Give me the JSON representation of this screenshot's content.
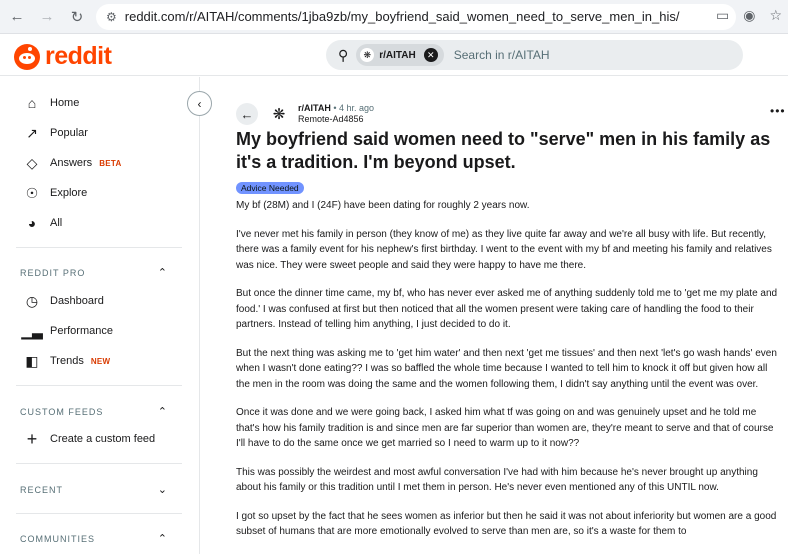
{
  "browser": {
    "url": "reddit.com/r/AITAH/comments/1jba9zb/my_boyfriend_said_women_need_to_serve_men_in_his/"
  },
  "header": {
    "logo_text": "reddit",
    "search_chip": "r/AITAH",
    "search_placeholder": "Search in r/AITAH"
  },
  "sidebar": {
    "items": [
      {
        "label": "Home",
        "icon": "home-icon"
      },
      {
        "label": "Popular",
        "icon": "popular-icon"
      },
      {
        "label": "Answers",
        "badge": "BETA",
        "icon": "answers-icon"
      },
      {
        "label": "Explore",
        "icon": "explore-icon"
      },
      {
        "label": "All",
        "icon": "all-icon"
      }
    ],
    "reddit_pro": {
      "title": "REDDIT PRO",
      "items": [
        {
          "label": "Dashboard",
          "icon": "dashboard-icon"
        },
        {
          "label": "Performance",
          "icon": "performance-icon"
        },
        {
          "label": "Trends",
          "badge": "NEW",
          "icon": "trends-icon"
        }
      ]
    },
    "custom_feeds": {
      "title": "CUSTOM FEEDS",
      "create_label": "Create a custom feed"
    },
    "recent_title": "RECENT",
    "communities_title": "COMMUNITIES"
  },
  "post": {
    "subreddit": "r/AITAH",
    "time": "• 4 hr. ago",
    "author": "Remote-Ad4856",
    "title": "My boyfriend said women need to \"serve\" men in his family as it's a tradition. I'm beyond upset.",
    "flair": "Advice Needed",
    "flair_color": "#7193ff",
    "paragraphs": [
      "My bf (28M) and I (24F) have been dating for roughly 2 years now.",
      "I've never met his family in person (they know of me) as they live quite far away and we're all busy with life. But recently, there was a family event for his nephew's first birthday. I went to the event with my bf and meeting his family and relatives was nice. They were sweet people and said they were happy to have me there.",
      "But once the dinner time came, my bf, who has never ever asked me of anything suddenly told me to 'get me my plate and food.' I was confused at first but then noticed that all the women present were taking care of handling the food to their partners. Instead of telling him anything, I just decided to do it.",
      "But the next thing was asking me to 'get him water' and then next 'get me tissues' and then next 'let's go wash hands' even when I wasn't done eating?? I was so baffled the whole time because I wanted to tell him to knock it off but given how all the men in the room was doing the same and the women following them, I didn't say anything until the event was over.",
      "Once it was done and we were going back, I asked him what tf was going on and was genuinely upset and he told me that's how his family tradition is and since men are far superior than women are, they're meant to serve and that of course I'll have to do the same once we get married so I need to warm up to it now??",
      "This was possibly the weirdest and most awful conversation I've had with him because he's never brought up anything about his family or this tradition until I met them in person. He's never even mentioned any of this UNTIL now.",
      "I got so upset by the fact that he sees women as inferior but then he said it was not about inferiority but women are a good subset of humans that are more emotionally evolved to serve than men are, so it's a waste for them to"
    ]
  },
  "colors": {
    "brand": "#ff4500",
    "beta_badge": "#d93a00"
  }
}
